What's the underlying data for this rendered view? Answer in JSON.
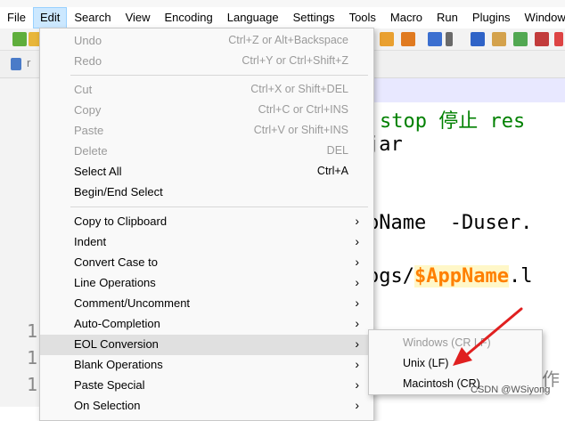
{
  "menubar": {
    "items": [
      "File",
      "Edit",
      "Search",
      "View",
      "Encoding",
      "Language",
      "Settings",
      "Tools",
      "Macro",
      "Run",
      "Plugins",
      "Window"
    ]
  },
  "editor": {
    "line_numbers": [
      "1",
      "1",
      "1"
    ],
    "lines": {
      "l1_green": "stop 停止 res",
      "l2": "jar",
      "l3": "pName  -Duser.",
      "l4_pre": "ogs/",
      "l4_var": "$AppName",
      "l4_post": ".l",
      "l5_partial": "作"
    }
  },
  "edit_menu": {
    "undo": {
      "label": "Undo",
      "shortcut": "Ctrl+Z or Alt+Backspace"
    },
    "redo": {
      "label": "Redo",
      "shortcut": "Ctrl+Y or Ctrl+Shift+Z"
    },
    "cut": {
      "label": "Cut",
      "shortcut": "Ctrl+X or Shift+DEL"
    },
    "copy": {
      "label": "Copy",
      "shortcut": "Ctrl+C or Ctrl+INS"
    },
    "paste": {
      "label": "Paste",
      "shortcut": "Ctrl+V or Shift+INS"
    },
    "delete": {
      "label": "Delete",
      "shortcut": "DEL"
    },
    "select_all": {
      "label": "Select All",
      "shortcut": "Ctrl+A"
    },
    "begin_end_select": {
      "label": "Begin/End Select"
    },
    "copy_to_clipboard": {
      "label": "Copy to Clipboard"
    },
    "indent": {
      "label": "Indent"
    },
    "convert_case": {
      "label": "Convert Case to"
    },
    "line_operations": {
      "label": "Line Operations"
    },
    "comment": {
      "label": "Comment/Uncomment"
    },
    "auto_completion": {
      "label": "Auto-Completion"
    },
    "eol_conversion": {
      "label": "EOL Conversion"
    },
    "blank_operations": {
      "label": "Blank Operations"
    },
    "paste_special": {
      "label": "Paste Special"
    },
    "on_selection": {
      "label": "On Selection"
    },
    "submenu_arrow": "›"
  },
  "eol_submenu": {
    "windows": "Windows (CR LF)",
    "unix": "Unix (LF)",
    "mac": "Macintosh (CR)"
  },
  "watermark": "CSDN @WSiyong",
  "colors": {
    "annotation_arrow": "#e02020",
    "highlight": "#e0e0e0",
    "keyword_green": "#008000",
    "variable_orange": "#ff8000"
  }
}
